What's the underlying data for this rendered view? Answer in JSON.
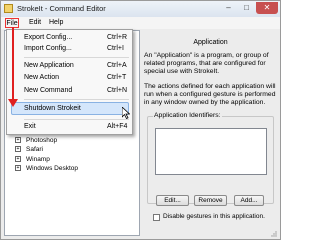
{
  "window": {
    "title": "StrokeIt - Command Editor"
  },
  "titlebar_buttons": {
    "minimize": "–",
    "maximize": "□",
    "close": "✕"
  },
  "menubar": [
    "File",
    "Edit",
    "Help"
  ],
  "file_menu": [
    {
      "label": "Export Config...",
      "shortcut": "Ctrl+R"
    },
    {
      "label": "Import Config...",
      "shortcut": "Ctrl+I"
    },
    {
      "label": "New Application",
      "shortcut": "Ctrl+A"
    },
    {
      "label": "New Action",
      "shortcut": "Ctrl+T"
    },
    {
      "label": "New Command",
      "shortcut": "Ctrl+N"
    },
    {
      "label": "Shutdown Strokeit",
      "shortcut": ""
    },
    {
      "label": "Exit",
      "shortcut": "Alt+F4"
    }
  ],
  "tree_items": [
    {
      "expander": "+",
      "label": "Photoshop"
    },
    {
      "expander": "+",
      "label": "Safari"
    },
    {
      "expander": "+",
      "label": "Winamp"
    },
    {
      "expander": "+",
      "label": "Windows Desktop"
    }
  ],
  "panel": {
    "heading": "Application",
    "description": [
      "An \"Application\" is a program, or group of",
      "related programs, that are configured for",
      "special use with StrokeIt."
    ],
    "actions_note": [
      "The actions defined for each application will",
      "run when a configured gesture is performed",
      "in any window owned by the application."
    ],
    "identifiers_label": "Application Identifiers:",
    "buttons": {
      "edit": "Edit...",
      "remove": "Remove",
      "add": "Add..."
    },
    "disable_checkbox_label": "Disable gestures in this application.",
    "disable_checked": false
  },
  "annotation": {
    "arrow_color": "#e02020"
  }
}
